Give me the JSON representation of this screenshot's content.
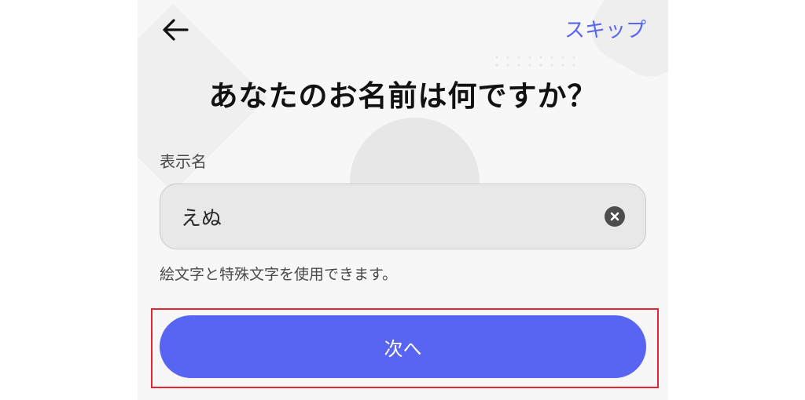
{
  "header": {
    "back_icon": "arrow-left-icon",
    "skip_label": "スキップ"
  },
  "title": "あなたのお名前は何ですか？",
  "form": {
    "display_name_label": "表示名",
    "display_name_value": "えぬ",
    "clear_icon": "clear-x-icon",
    "hint": "絵文字と特殊文字を使用できます。"
  },
  "next_button_label": "次へ",
  "colors": {
    "accent": "#5865f2",
    "highlight_border": "#e8232f",
    "input_bg": "#e8e8e8"
  }
}
